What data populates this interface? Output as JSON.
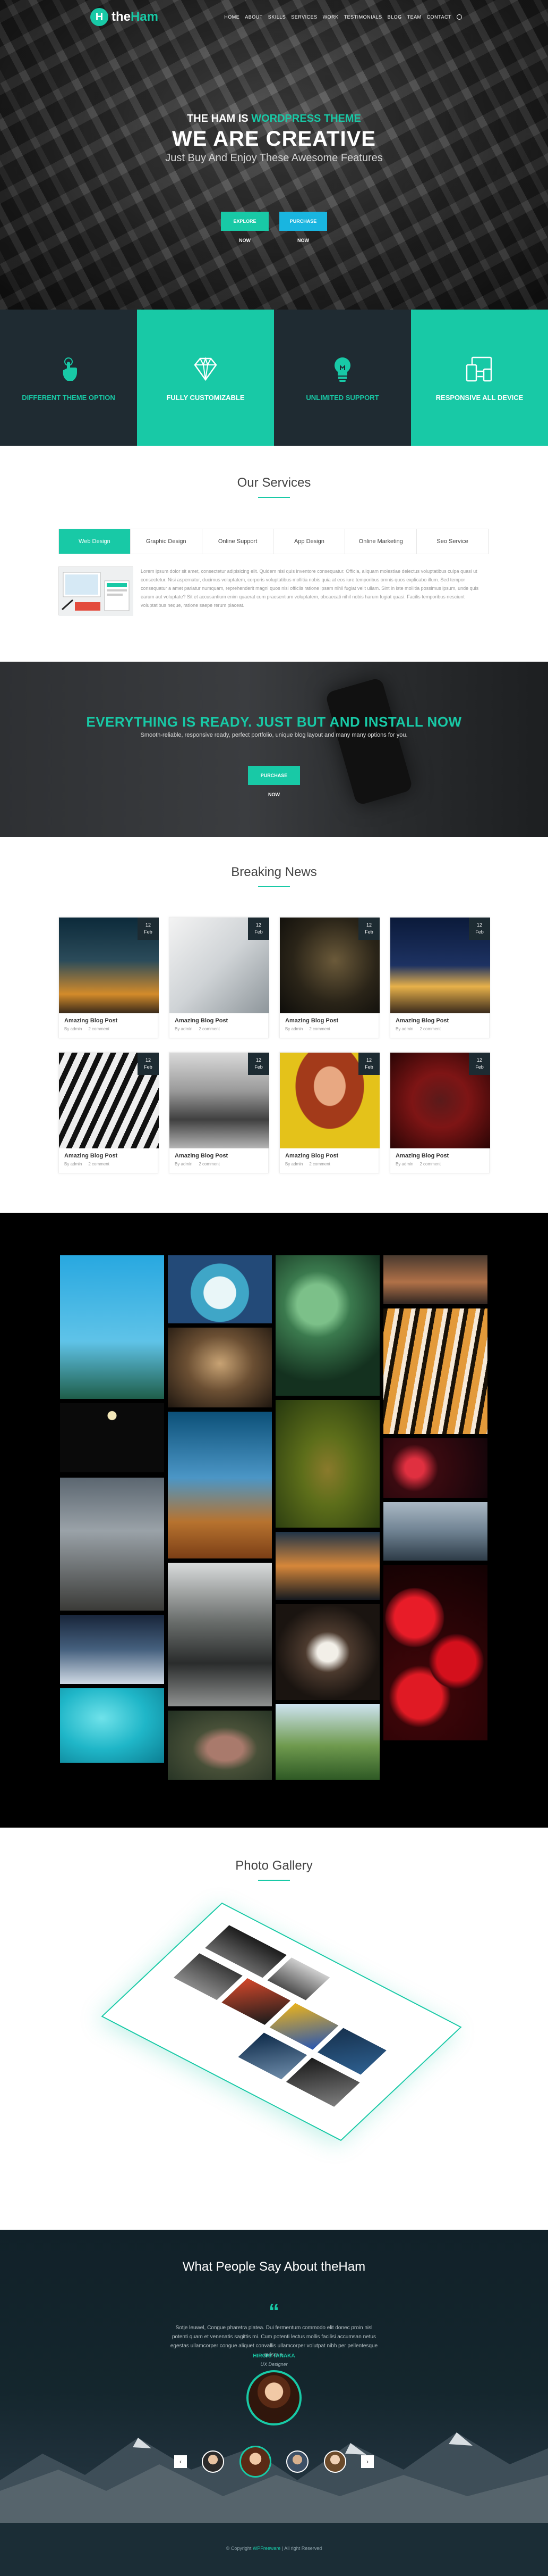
{
  "brand": {
    "name_prefix": "the",
    "name_suffix": "Ham",
    "mark": "H",
    "accent": "#18c9a6"
  },
  "nav": {
    "items": [
      "HOME",
      "ABOUT",
      "SKILLS",
      "SERVICES",
      "WORK",
      "TESTIMONIALS",
      "BLOG",
      "TEAM",
      "CONTACT"
    ]
  },
  "hero": {
    "kicker_prefix": "THE HAM IS ",
    "kicker_accent": "WORDPRESS THEME",
    "title": "WE ARE CREATIVE",
    "subtitle": "Just Buy And Enjoy These Awesome Features",
    "btn_explore": "EXPLORE NOW",
    "btn_purchase": "PURCHASE NOW"
  },
  "features": [
    {
      "label": "DIFFERENT THEME OPTION",
      "icon": "hand-touch-icon",
      "style": "dark"
    },
    {
      "label": "FULLY CUSTOMIZABLE",
      "icon": "diamond-icon",
      "style": "green"
    },
    {
      "label": "UNLIMITED SUPPORT",
      "icon": "lightbulb-icon",
      "style": "dark"
    },
    {
      "label": "RESPONSIVE ALL DEVICE",
      "icon": "devices-icon",
      "style": "green"
    }
  ],
  "services": {
    "title": "Our Services",
    "tabs": [
      "Web Design",
      "Graphic Design",
      "Online Support",
      "App Design",
      "Online Marketing",
      "Seo Service"
    ],
    "active_tab": 0,
    "body": "Lorem ipsum dolor sit amet, consectetur adipisicing elit. Quidem nisi quis inventore consequatur. Officia, aliquam molestiae delectus voluptatibus culpa quasi ut consectetur. Nisi aspernatur, ducimus voluptatem, corporis voluptatibus mollitia nobis quia at eos iure temporibus omnis quos explicabo illum. Sed tempor consequatur a amet pariatur numquam, reprehenderit magni quos nisi officiis ratione ipsam nihil fugiat velit ullam. Sint in iste mollitia possimus ipsum, unde quis earum aut voluptate? Sit et accusantium enim quaerat cum praesentium voluptatem, obcaecati nihil nobis harum fugiat quasi. Facilis temporibus nesciunt voluptatibus neque, ratione saepe rerum placeat."
  },
  "cta": {
    "title": "EVERYTHING IS READY. JUST BUT AND INSTALL NOW",
    "subtitle": "Smooth-reliable, responsive ready, perfect portfolio, unique blog layout and many many options for you.",
    "button": "PURCHASE NOW"
  },
  "news": {
    "title": "Breaking News",
    "posts": [
      {
        "day": "12",
        "month": "Feb",
        "title": "Amazing Blog Post",
        "author": "By admin",
        "comments": "2 comment"
      },
      {
        "day": "12",
        "month": "Feb",
        "title": "Amazing Blog Post",
        "author": "By admin",
        "comments": "2 comment"
      },
      {
        "day": "12",
        "month": "Feb",
        "title": "Amazing Blog Post",
        "author": "By admin",
        "comments": "2 comment"
      },
      {
        "day": "12",
        "month": "Feb",
        "title": "Amazing Blog Post",
        "author": "By admin",
        "comments": "2 comment"
      },
      {
        "day": "12",
        "month": "Feb",
        "title": "Amazing Blog Post",
        "author": "By admin",
        "comments": "2 comment"
      },
      {
        "day": "12",
        "month": "Feb",
        "title": "Amazing Blog Post",
        "author": "By admin",
        "comments": "2 comment"
      },
      {
        "day": "12",
        "month": "Feb",
        "title": "Amazing Blog Post",
        "author": "By admin",
        "comments": "2 comment"
      },
      {
        "day": "12",
        "month": "Feb",
        "title": "Amazing Blog Post",
        "author": "By admin",
        "comments": "2 comment"
      }
    ]
  },
  "gallery": {
    "title": "Photo Gallery"
  },
  "testimonials": {
    "title": "What People Say About theHam",
    "quote_mark": "“",
    "body": "Sotje leuwel, Congue pharetra platea. Dui fermentum commodo elit donec proin nisl potenti quam et venenatis sagittis mi. Cum potenti lectus mollis facilisi accumsan netus egestas ullamcorper congue aliquet convallis ullamcorper volutpat nibh per pellentesque quisque.",
    "name": "HIROKI TANAKA",
    "role": "UX Designer",
    "prev": "‹",
    "next": "›"
  },
  "footer": {
    "prefix": "© Copyright ",
    "brand": "WPFreeware",
    "suffix": " | All right Reserved"
  }
}
